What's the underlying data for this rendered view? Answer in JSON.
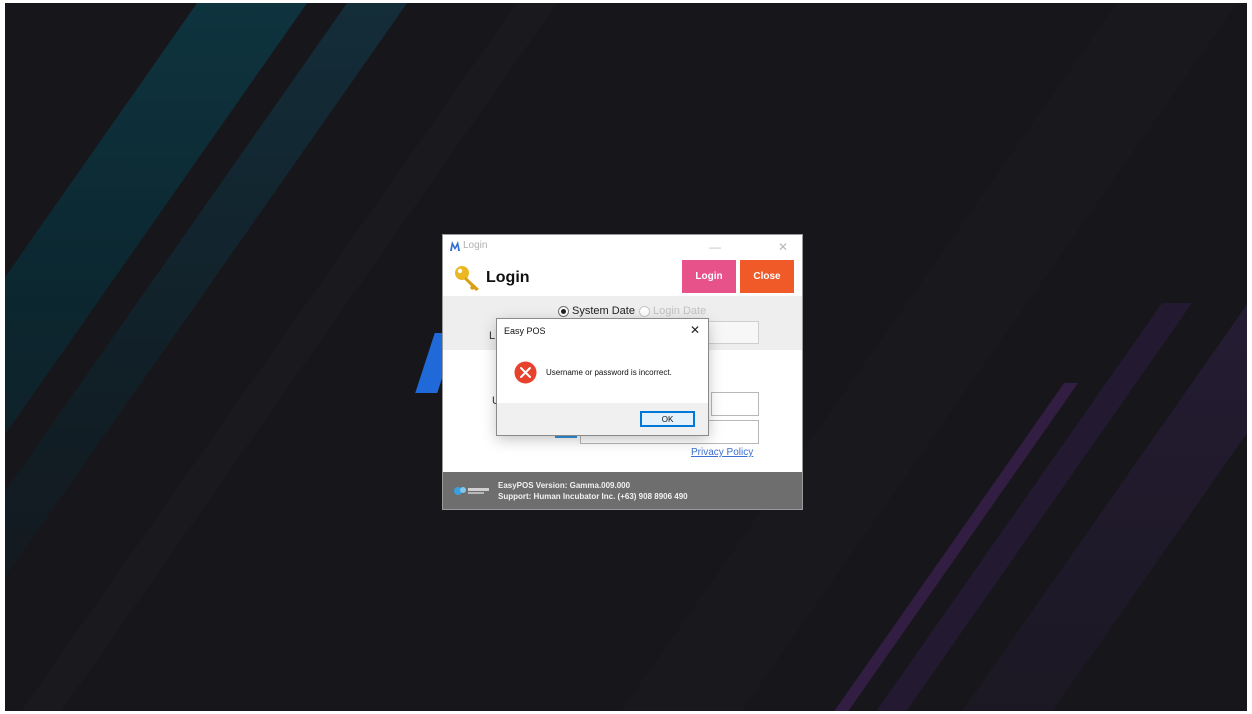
{
  "login_window": {
    "title": "Login",
    "heading": "Login",
    "minimize_glyph": "—",
    "close_glyph": "✕",
    "buttons": {
      "login": "Login",
      "close": "Close"
    },
    "radio": {
      "system_date": "System Date",
      "login_date": "Login Date",
      "selected": "System Date"
    },
    "partial_label_date": "L",
    "partial_label_user": "U",
    "privacy_link": "Privacy Policy",
    "footer": {
      "version": "EasyPOS Version: Gamma.009.000",
      "support": "Support: Human Incubator Inc. (+63) 908 8906 490"
    },
    "colors": {
      "login_button": "#e8528a",
      "close_button": "#f05a28",
      "footer": "#6e6e6e"
    }
  },
  "message_box": {
    "title": "Easy POS",
    "close_glyph": "✕",
    "message": "Username or password is incorrect.",
    "ok_label": "OK",
    "icon": "error-icon"
  },
  "icons": [
    "app-logo-icon",
    "key-icon",
    "error-icon",
    "company-logo-icon"
  ]
}
